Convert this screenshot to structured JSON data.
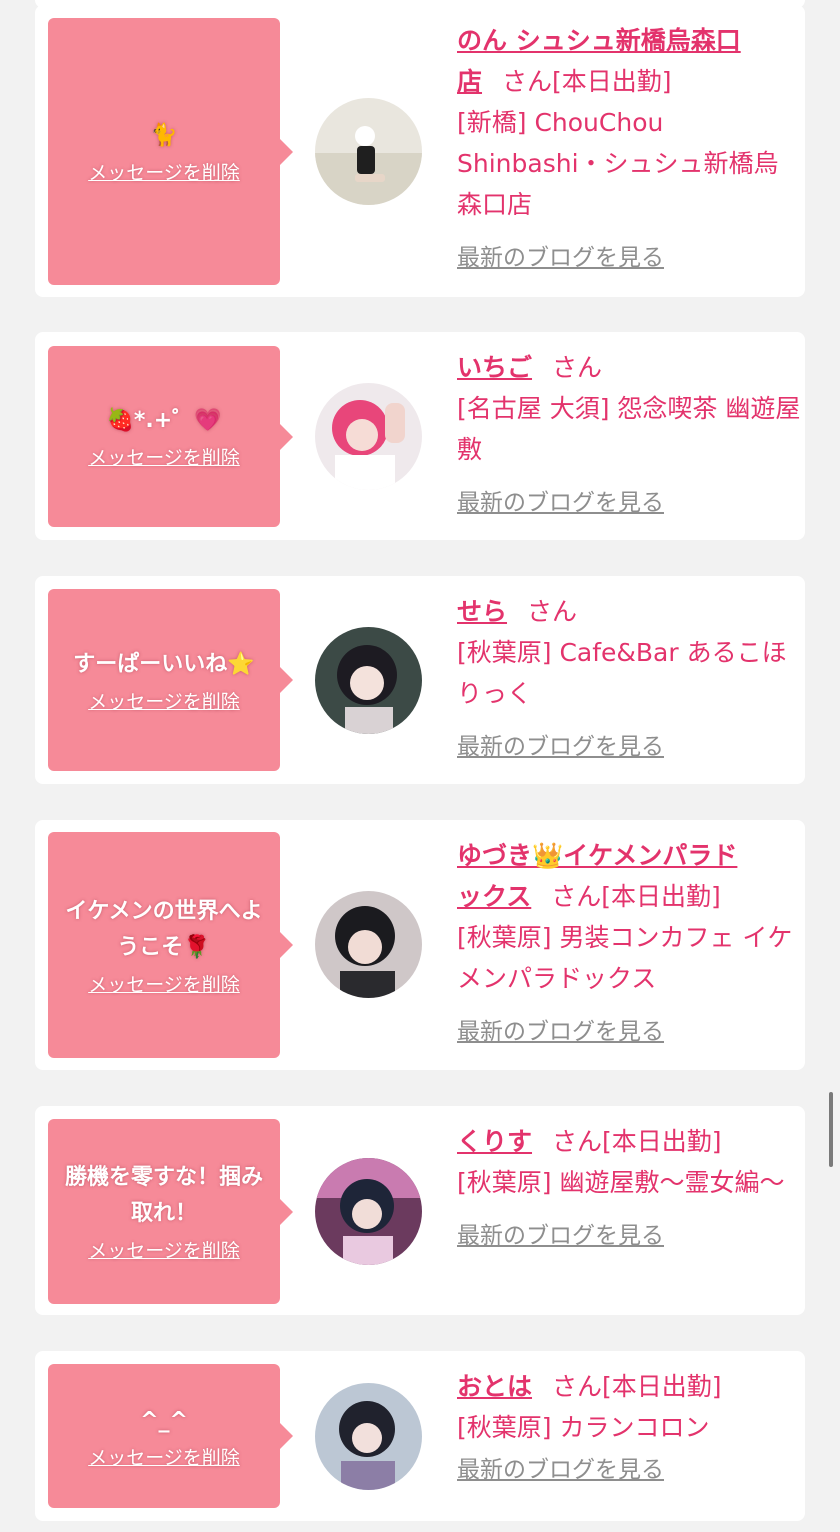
{
  "common": {
    "delete_label": "メッセージを削除",
    "blog_label": "最新のブログを見る",
    "san": "さん"
  },
  "colors": {
    "accent": "#e3336c",
    "bubble": "#f68a98",
    "background": "#f2f2f2",
    "link_gray": "#8e8e8e"
  },
  "cards": [
    {
      "message": "🐈",
      "name_line1": "のん シュシュ新橋烏森口",
      "name_line2": "店",
      "status": "[本日出勤]",
      "shop": "[新橋] ChouChou Shinbashi・シュシュ新橋烏森口店"
    },
    {
      "message": "🍓*.+゜💗",
      "name_line1": "いちご",
      "name_line2": "",
      "status": "",
      "shop": "[名古屋 大須] 怨念喫茶 幽遊屋敷"
    },
    {
      "message": "すーぱーいいね⭐",
      "name_line1": "せら",
      "name_line2": "",
      "status": "",
      "shop": "[秋葉原] Cafe&Bar あるこほりっく"
    },
    {
      "message": "イケメンの世界へようこそ🌹",
      "name_line1": "ゆづき👑イケメンパラド",
      "name_line2": "ックス",
      "status": "[本日出勤]",
      "shop": "[秋葉原] 男装コンカフェ イケメンパラドックス"
    },
    {
      "message": "勝機を零すな！掴み取れ！",
      "name_line1": "くりす",
      "name_line2": "",
      "status": "[本日出勤]",
      "shop": "[秋葉原] 幽遊屋敷〜霊女編〜"
    },
    {
      "message": "^_^",
      "name_line1": "おとは",
      "name_line2": "",
      "status": "[本日出勤]",
      "shop": "[秋葉原] カランコロン"
    }
  ]
}
